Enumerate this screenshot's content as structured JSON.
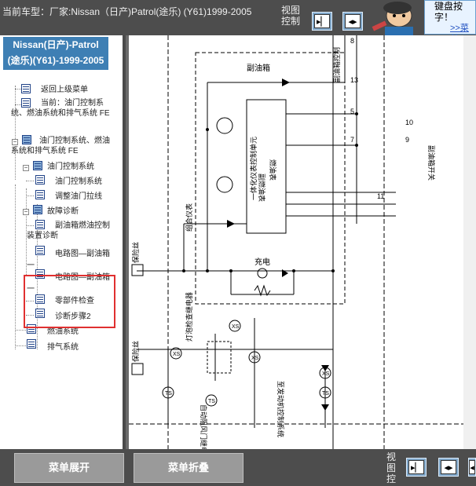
{
  "header": {
    "current_model": "当前车型：厂家:Nissan（日产)Patrol(途乐) (Y61)1999-2005",
    "view_control_label": "视图控制",
    "ad_text": "键盘按字！",
    "ad_link": ">>菜单"
  },
  "sidebar": {
    "title_line1": "Nissan(日产)-Patrol",
    "title_line2": "(途乐)(Y61)-1999-2005",
    "items": [
      {
        "label": "返回上级菜单"
      },
      {
        "label": "当前：油门控制系统、燃油系统和排气系统 FE"
      },
      {
        "label": "油门控制系统、燃油系统和排气系统 FE"
      },
      {
        "label": "油门控制系统"
      },
      {
        "label": "油门控制系统"
      },
      {
        "label": "调整油门拉线"
      },
      {
        "label": "故障诊断"
      },
      {
        "label": "副油箱燃油控制装置诊断"
      },
      {
        "label": "电路图—副油箱一"
      },
      {
        "label": "电路图—副油箱一"
      },
      {
        "label": "零部件检查"
      },
      {
        "label": "诊断步骤2"
      },
      {
        "label": "燃油系统"
      },
      {
        "label": "排气系统"
      }
    ]
  },
  "diagram": {
    "labels": {
      "sub_tank": "副油箱",
      "sub_gauge": "副燃油表",
      "fuel_gauge": "燃油表",
      "control_unit": "一体化仪表控制单元",
      "combo_meter": "组合仪表",
      "fuse1": "保险丝",
      "fuse2": "保险丝",
      "charge": "充电",
      "lamp_relay": "灯泡检查继电器",
      "door_relay": "自动阻风门继电器",
      "engine_ctrl": "至发动机控制系统",
      "sub_ctrl": "副油箱控制",
      "sub_switch": "副油箱开关",
      "xs": "XS",
      "ts": "TS",
      "pins": [
        "8",
        "13",
        "5",
        "7",
        "9",
        "10",
        "11"
      ]
    }
  },
  "footer": {
    "expand_label": "菜单展开",
    "collapse_label": "菜单折叠",
    "view_control_label": "视图控"
  }
}
